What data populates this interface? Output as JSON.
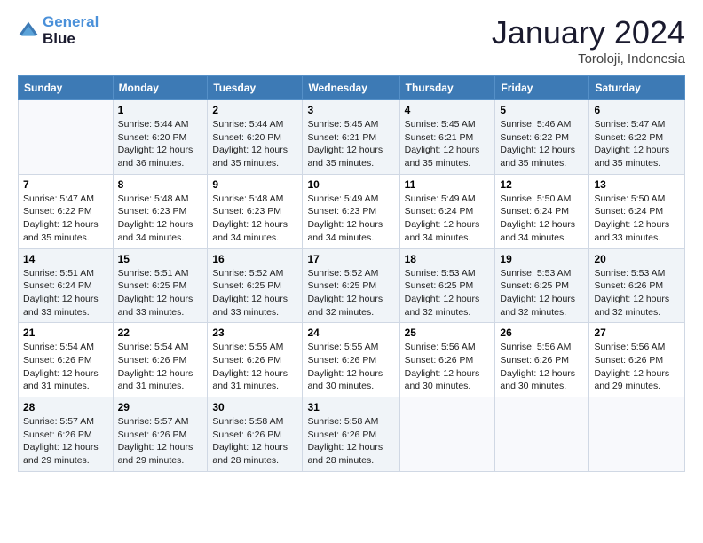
{
  "header": {
    "logo_line1": "General",
    "logo_line2": "Blue",
    "month_title": "January 2024",
    "location": "Toroloji, Indonesia"
  },
  "days_of_week": [
    "Sunday",
    "Monday",
    "Tuesday",
    "Wednesday",
    "Thursday",
    "Friday",
    "Saturday"
  ],
  "weeks": [
    [
      {
        "day": "",
        "info": ""
      },
      {
        "day": "1",
        "info": "Sunrise: 5:44 AM\nSunset: 6:20 PM\nDaylight: 12 hours\nand 36 minutes."
      },
      {
        "day": "2",
        "info": "Sunrise: 5:44 AM\nSunset: 6:20 PM\nDaylight: 12 hours\nand 35 minutes."
      },
      {
        "day": "3",
        "info": "Sunrise: 5:45 AM\nSunset: 6:21 PM\nDaylight: 12 hours\nand 35 minutes."
      },
      {
        "day": "4",
        "info": "Sunrise: 5:45 AM\nSunset: 6:21 PM\nDaylight: 12 hours\nand 35 minutes."
      },
      {
        "day": "5",
        "info": "Sunrise: 5:46 AM\nSunset: 6:22 PM\nDaylight: 12 hours\nand 35 minutes."
      },
      {
        "day": "6",
        "info": "Sunrise: 5:47 AM\nSunset: 6:22 PM\nDaylight: 12 hours\nand 35 minutes."
      }
    ],
    [
      {
        "day": "7",
        "info": "Sunrise: 5:47 AM\nSunset: 6:22 PM\nDaylight: 12 hours\nand 35 minutes."
      },
      {
        "day": "8",
        "info": "Sunrise: 5:48 AM\nSunset: 6:23 PM\nDaylight: 12 hours\nand 34 minutes."
      },
      {
        "day": "9",
        "info": "Sunrise: 5:48 AM\nSunset: 6:23 PM\nDaylight: 12 hours\nand 34 minutes."
      },
      {
        "day": "10",
        "info": "Sunrise: 5:49 AM\nSunset: 6:23 PM\nDaylight: 12 hours\nand 34 minutes."
      },
      {
        "day": "11",
        "info": "Sunrise: 5:49 AM\nSunset: 6:24 PM\nDaylight: 12 hours\nand 34 minutes."
      },
      {
        "day": "12",
        "info": "Sunrise: 5:50 AM\nSunset: 6:24 PM\nDaylight: 12 hours\nand 34 minutes."
      },
      {
        "day": "13",
        "info": "Sunrise: 5:50 AM\nSunset: 6:24 PM\nDaylight: 12 hours\nand 33 minutes."
      }
    ],
    [
      {
        "day": "14",
        "info": "Sunrise: 5:51 AM\nSunset: 6:24 PM\nDaylight: 12 hours\nand 33 minutes."
      },
      {
        "day": "15",
        "info": "Sunrise: 5:51 AM\nSunset: 6:25 PM\nDaylight: 12 hours\nand 33 minutes."
      },
      {
        "day": "16",
        "info": "Sunrise: 5:52 AM\nSunset: 6:25 PM\nDaylight: 12 hours\nand 33 minutes."
      },
      {
        "day": "17",
        "info": "Sunrise: 5:52 AM\nSunset: 6:25 PM\nDaylight: 12 hours\nand 32 minutes."
      },
      {
        "day": "18",
        "info": "Sunrise: 5:53 AM\nSunset: 6:25 PM\nDaylight: 12 hours\nand 32 minutes."
      },
      {
        "day": "19",
        "info": "Sunrise: 5:53 AM\nSunset: 6:25 PM\nDaylight: 12 hours\nand 32 minutes."
      },
      {
        "day": "20",
        "info": "Sunrise: 5:53 AM\nSunset: 6:26 PM\nDaylight: 12 hours\nand 32 minutes."
      }
    ],
    [
      {
        "day": "21",
        "info": "Sunrise: 5:54 AM\nSunset: 6:26 PM\nDaylight: 12 hours\nand 31 minutes."
      },
      {
        "day": "22",
        "info": "Sunrise: 5:54 AM\nSunset: 6:26 PM\nDaylight: 12 hours\nand 31 minutes."
      },
      {
        "day": "23",
        "info": "Sunrise: 5:55 AM\nSunset: 6:26 PM\nDaylight: 12 hours\nand 31 minutes."
      },
      {
        "day": "24",
        "info": "Sunrise: 5:55 AM\nSunset: 6:26 PM\nDaylight: 12 hours\nand 30 minutes."
      },
      {
        "day": "25",
        "info": "Sunrise: 5:56 AM\nSunset: 6:26 PM\nDaylight: 12 hours\nand 30 minutes."
      },
      {
        "day": "26",
        "info": "Sunrise: 5:56 AM\nSunset: 6:26 PM\nDaylight: 12 hours\nand 30 minutes."
      },
      {
        "day": "27",
        "info": "Sunrise: 5:56 AM\nSunset: 6:26 PM\nDaylight: 12 hours\nand 29 minutes."
      }
    ],
    [
      {
        "day": "28",
        "info": "Sunrise: 5:57 AM\nSunset: 6:26 PM\nDaylight: 12 hours\nand 29 minutes."
      },
      {
        "day": "29",
        "info": "Sunrise: 5:57 AM\nSunset: 6:26 PM\nDaylight: 12 hours\nand 29 minutes."
      },
      {
        "day": "30",
        "info": "Sunrise: 5:58 AM\nSunset: 6:26 PM\nDaylight: 12 hours\nand 28 minutes."
      },
      {
        "day": "31",
        "info": "Sunrise: 5:58 AM\nSunset: 6:26 PM\nDaylight: 12 hours\nand 28 minutes."
      },
      {
        "day": "",
        "info": ""
      },
      {
        "day": "",
        "info": ""
      },
      {
        "day": "",
        "info": ""
      }
    ]
  ]
}
